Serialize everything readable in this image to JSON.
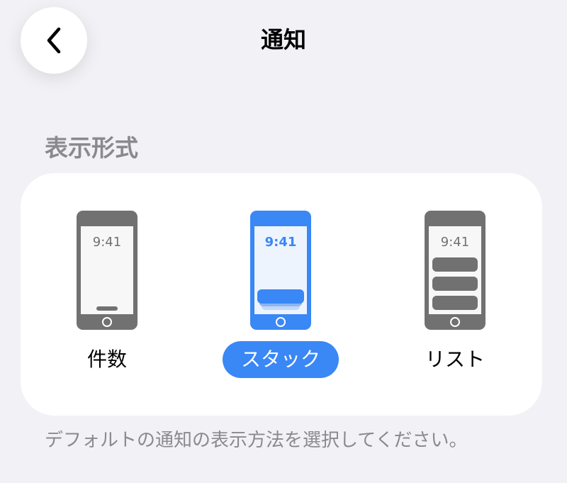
{
  "header": {
    "back_icon": "chevron-left-icon",
    "title": "通知"
  },
  "section": {
    "title": "表示形式"
  },
  "options": [
    {
      "label": "件数",
      "time": "9:41",
      "selected": false
    },
    {
      "label": "スタック",
      "time": "9:41",
      "selected": true
    },
    {
      "label": "リスト",
      "time": "9:41",
      "selected": false
    }
  ],
  "footer": {
    "note": "デフォルトの通知の表示方法を選択してください。"
  },
  "colors": {
    "accent": "#3a87f6",
    "phone_gray": "#717171",
    "background": "#f1f1f6",
    "secondary_text": "#8a8a8e"
  }
}
